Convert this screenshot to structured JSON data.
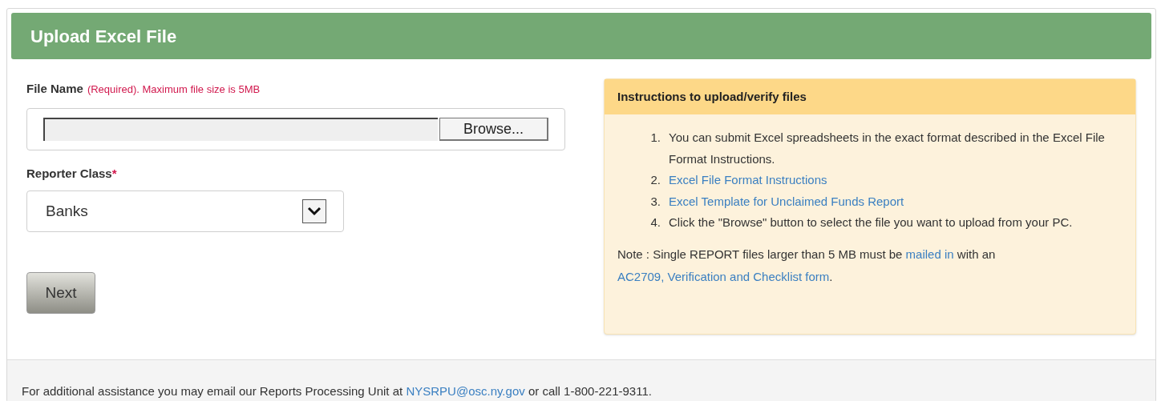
{
  "header": {
    "title": "Upload Excel File"
  },
  "file_field": {
    "label": "File Name",
    "hint": "(Required). Maximum file size is 5MB",
    "button": "Browse..."
  },
  "reporter_class": {
    "label": "Reporter Class",
    "required_mark": "*",
    "value": "Banks"
  },
  "next_button": "Next",
  "instructions": {
    "title": "Instructions to upload/verify files",
    "items": [
      {
        "number": "1.",
        "kind": "text",
        "text": "You can submit Excel spreadsheets in the exact format described in the Excel File Format Instructions."
      },
      {
        "number": "2.",
        "kind": "link",
        "text": "Excel File Format Instructions"
      },
      {
        "number": "3.",
        "kind": "link",
        "text": "Excel Template for Unclaimed Funds Report"
      },
      {
        "number": "4.",
        "kind": "text",
        "text": "Click the \"Browse\" button to select the file you want to upload from your PC."
      }
    ],
    "note": [
      {
        "kind": "text",
        "text": "Note : Single REPORT files larger than 5 MB must be "
      },
      {
        "kind": "link",
        "text": "mailed in"
      },
      {
        "kind": "text",
        "text": " with an "
      },
      {
        "kind": "link",
        "text": "AC2709, Verification and Checklist form"
      },
      {
        "kind": "text",
        "text": "."
      }
    ]
  },
  "footer": [
    {
      "kind": "text",
      "text": "For additional assistance you may email our Reports Processing Unit at "
    },
    {
      "kind": "link",
      "text": "NYSRPU@osc.ny.gov"
    },
    {
      "kind": "text",
      "text": " or call 1-800-221-9311."
    }
  ]
}
